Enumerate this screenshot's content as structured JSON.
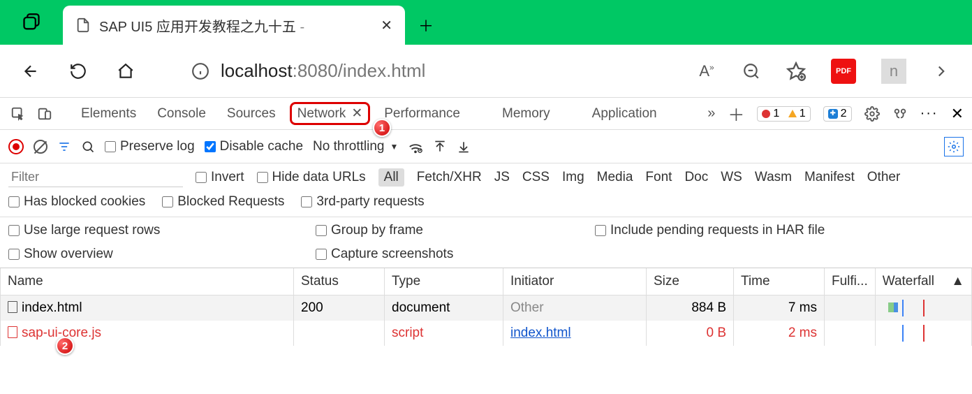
{
  "browser": {
    "tab_title": "SAP UI5 应用开发教程之九十五",
    "tab_suffix": " - ",
    "url_prefix": "localhost",
    "url_port": ":8080",
    "url_path": "/index.html"
  },
  "devtools": {
    "tabs": {
      "elements": "Elements",
      "console": "Console",
      "sources": "Sources",
      "network": "Network",
      "performance": "Performance",
      "memory": "Memory",
      "application": "Application"
    },
    "badges": {
      "errors": "1",
      "warnings": "1",
      "messages": "2"
    }
  },
  "toolbar": {
    "preserve_log": "Preserve log",
    "disable_cache": "Disable cache",
    "throttling": "No throttling"
  },
  "filters": {
    "placeholder": "Filter",
    "invert": "Invert",
    "hide_data_urls": "Hide data URLs",
    "types": {
      "all": "All",
      "fetchxhr": "Fetch/XHR",
      "js": "JS",
      "css": "CSS",
      "img": "Img",
      "media": "Media",
      "font": "Font",
      "doc": "Doc",
      "ws": "WS",
      "wasm": "Wasm",
      "manifest": "Manifest",
      "other": "Other"
    },
    "has_blocked": "Has blocked cookies",
    "blocked_req": "Blocked Requests",
    "third_party": "3rd-party requests"
  },
  "settings": {
    "large_rows": "Use large request rows",
    "group_frame": "Group by frame",
    "include_har": "Include pending requests in HAR file",
    "show_overview": "Show overview",
    "capture_ss": "Capture screenshots"
  },
  "table": {
    "headers": {
      "name": "Name",
      "status": "Status",
      "type": "Type",
      "initiator": "Initiator",
      "size": "Size",
      "time": "Time",
      "fulfilled": "Fulfi...",
      "waterfall": "Waterfall"
    },
    "rows": [
      {
        "name": "index.html",
        "status": "200",
        "type": "document",
        "initiator": "Other",
        "size": "884 B",
        "time": "7 ms"
      },
      {
        "name": "sap-ui-core.js",
        "status": "",
        "type": "script",
        "initiator": "index.html",
        "size": "0 B",
        "time": "2 ms"
      }
    ]
  },
  "callouts": {
    "c1": "1",
    "c2": "2"
  }
}
